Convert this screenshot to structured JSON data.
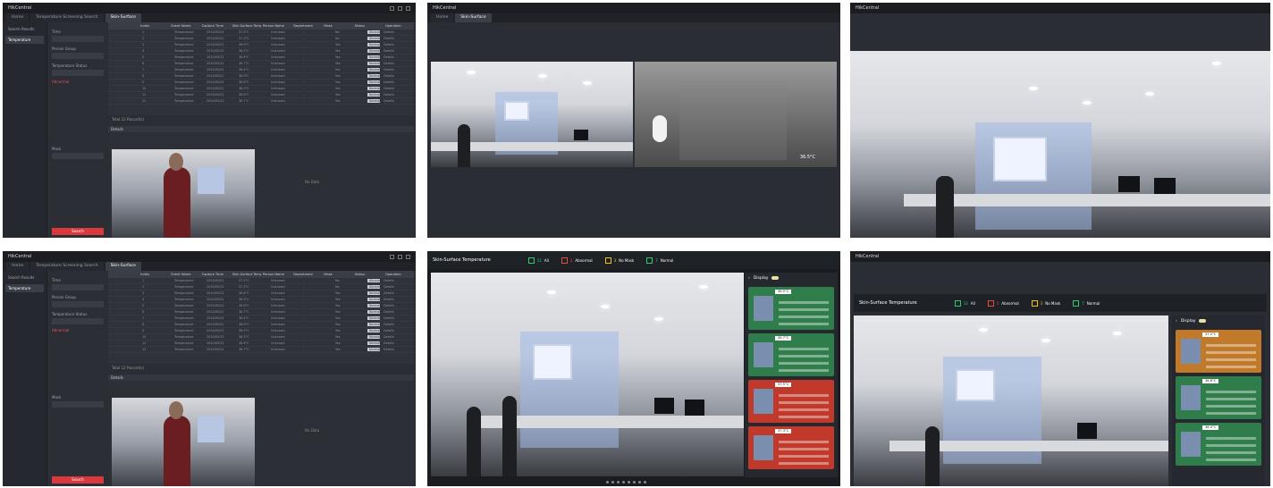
{
  "client": {
    "app_name": "HikCentral",
    "tab_home": "Home",
    "tab_search": "Temperature Screening Search",
    "tab_active": "Skin-Surface",
    "nav_items": [
      "Search Results",
      "Temperature"
    ],
    "filter": {
      "time_label": "Time",
      "time_value": "Today",
      "group_label": "Person Group",
      "temp_label": "Temperature Status",
      "abnormal": "Abnormal",
      "mask_label": "Mask",
      "search_button": "Search"
    },
    "table": {
      "headers": [
        "",
        "Index",
        "Event Name",
        "Capture Time",
        "Skin-Surface Temp",
        "Person Name",
        "Department",
        "Mask",
        "Status",
        "Operation"
      ],
      "rows": [
        [
          "",
          "1",
          "Temperature",
          "2020/05/22",
          "37.5°C",
          "Unknown",
          "-",
          "No",
          "Abnormal",
          "Details"
        ],
        [
          "",
          "2",
          "Temperature",
          "2020/05/22",
          "37.3°C",
          "Unknown",
          "-",
          "No",
          "Abnormal",
          "Details"
        ],
        [
          "",
          "3",
          "Temperature",
          "2020/05/22",
          "36.8°C",
          "Unknown",
          "-",
          "Yes",
          "Normal",
          "Details"
        ],
        [
          "",
          "4",
          "Temperature",
          "2020/05/22",
          "36.5°C",
          "Unknown",
          "-",
          "Yes",
          "Normal",
          "Details"
        ],
        [
          "",
          "5",
          "Temperature",
          "2020/05/22",
          "36.6°C",
          "Unknown",
          "-",
          "Yes",
          "Normal",
          "Details"
        ],
        [
          "",
          "6",
          "Temperature",
          "2020/05/22",
          "36.7°C",
          "Unknown",
          "-",
          "Yes",
          "Normal",
          "Details"
        ],
        [
          "",
          "7",
          "Temperature",
          "2020/05/22",
          "36.4°C",
          "Unknown",
          "-",
          "Yes",
          "Normal",
          "Details"
        ],
        [
          "",
          "8",
          "Temperature",
          "2020/05/22",
          "36.9°C",
          "Unknown",
          "-",
          "Yes",
          "Normal",
          "Details"
        ],
        [
          "",
          "9",
          "Temperature",
          "2020/05/22",
          "36.5°C",
          "Unknown",
          "-",
          "Yes",
          "Normal",
          "Details"
        ],
        [
          "",
          "10",
          "Temperature",
          "2020/05/22",
          "36.3°C",
          "Unknown",
          "-",
          "Yes",
          "Normal",
          "Details"
        ],
        [
          "",
          "11",
          "Temperature",
          "2020/05/22",
          "36.6°C",
          "Unknown",
          "-",
          "Yes",
          "Normal",
          "Details"
        ],
        [
          "",
          "12",
          "Temperature",
          "2020/05/22",
          "36.7°C",
          "Unknown",
          "-",
          "Yes",
          "Normal",
          "Details"
        ]
      ]
    },
    "pager": "Total 12 Record(s)",
    "details_title": "Details",
    "no_data": "No Data"
  },
  "monitor": {
    "title": "Skin-Surface Temperature",
    "stats": [
      {
        "label": "All",
        "value": "12",
        "color": "#2ecc71"
      },
      {
        "label": "Abnormal",
        "value": "2",
        "color": "#e74c3c"
      },
      {
        "label": "No Mask",
        "value": "3",
        "color": "#f1c40f"
      },
      {
        "label": "Normal",
        "value": "7",
        "color": "#2ecc71"
      }
    ],
    "sidebar_title": "Display",
    "cards": [
      {
        "tag": "36.5°C",
        "color": "green"
      },
      {
        "tag": "36.7°C",
        "color": "green"
      },
      {
        "tag": "37.5°C",
        "color": "red"
      },
      {
        "tag": "37.3°C",
        "color": "red"
      }
    ],
    "cards6": [
      {
        "tag": "37.2°C",
        "color": "orange"
      },
      {
        "tag": "36.6°C",
        "color": "green"
      },
      {
        "tag": "36.4°C",
        "color": "green"
      }
    ],
    "thermal_reading": "36.5°C"
  }
}
